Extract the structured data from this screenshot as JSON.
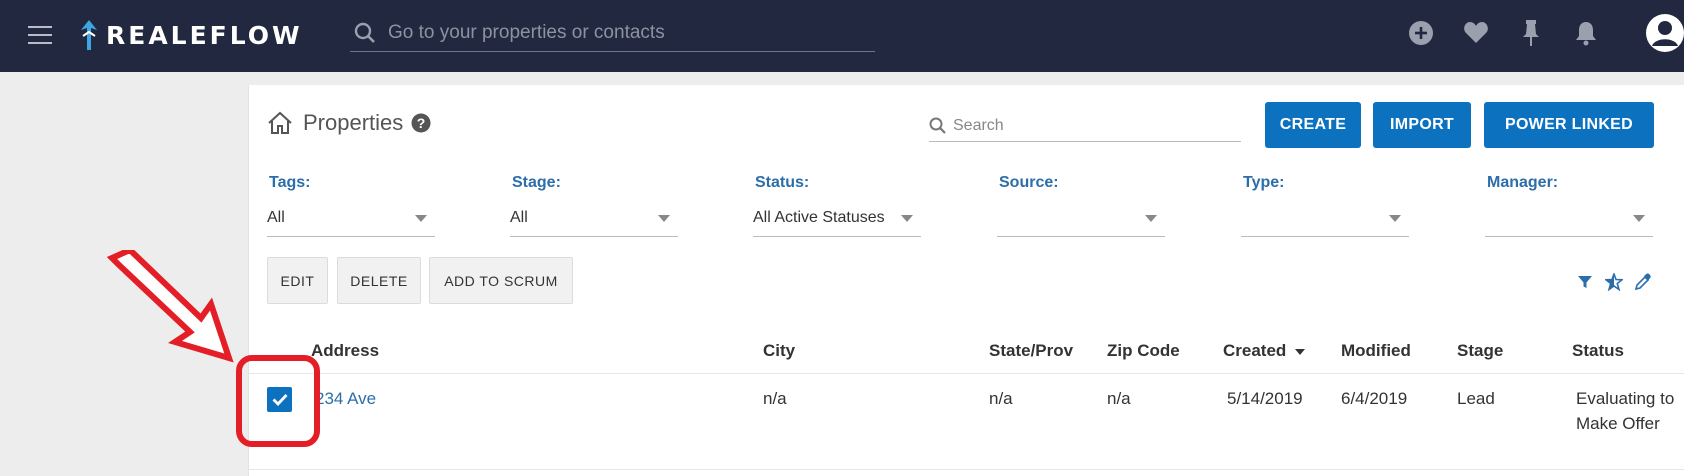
{
  "header": {
    "brand": "REALEFLOW",
    "search_placeholder": "Go to your properties or contacts",
    "icons": [
      "menu-icon",
      "plus-circle-icon",
      "heart-icon",
      "pin-icon",
      "bell-icon",
      "user-avatar-icon"
    ]
  },
  "page": {
    "title": "Properties",
    "search_placeholder": "Search",
    "actions": {
      "create": "CREATE",
      "import": "IMPORT",
      "power_linked": "POWER LINKED"
    }
  },
  "filters": [
    {
      "label": "Tags:",
      "value": "All"
    },
    {
      "label": "Stage:",
      "value": "All"
    },
    {
      "label": "Status:",
      "value": "All Active Statuses"
    },
    {
      "label": "Source:",
      "value": ""
    },
    {
      "label": "Type:",
      "value": ""
    },
    {
      "label": "Manager:",
      "value": ""
    }
  ],
  "bulk_actions": {
    "edit": "EDIT",
    "delete": "DELETE",
    "add_to_scrum": "ADD TO SCRUM"
  },
  "table": {
    "columns": [
      "Address",
      "City",
      "State/Prov",
      "Zip Code",
      "Created",
      "Modified",
      "Stage",
      "Status"
    ],
    "sort": {
      "column": "Created",
      "direction": "descending"
    },
    "rows": [
      {
        "selected": true,
        "address": "234 Ave",
        "city": "n/a",
        "state": "n/a",
        "zip": "n/a",
        "created": "5/14/2019",
        "modified": "6/4/2019",
        "stage": "Lead",
        "status": "Evaluating to Make Offer"
      }
    ]
  },
  "colors": {
    "header_bg": "#222840",
    "primary": "#0c72c0",
    "label_blue": "#2c6ea9",
    "annotation_red": "#e41e26"
  }
}
